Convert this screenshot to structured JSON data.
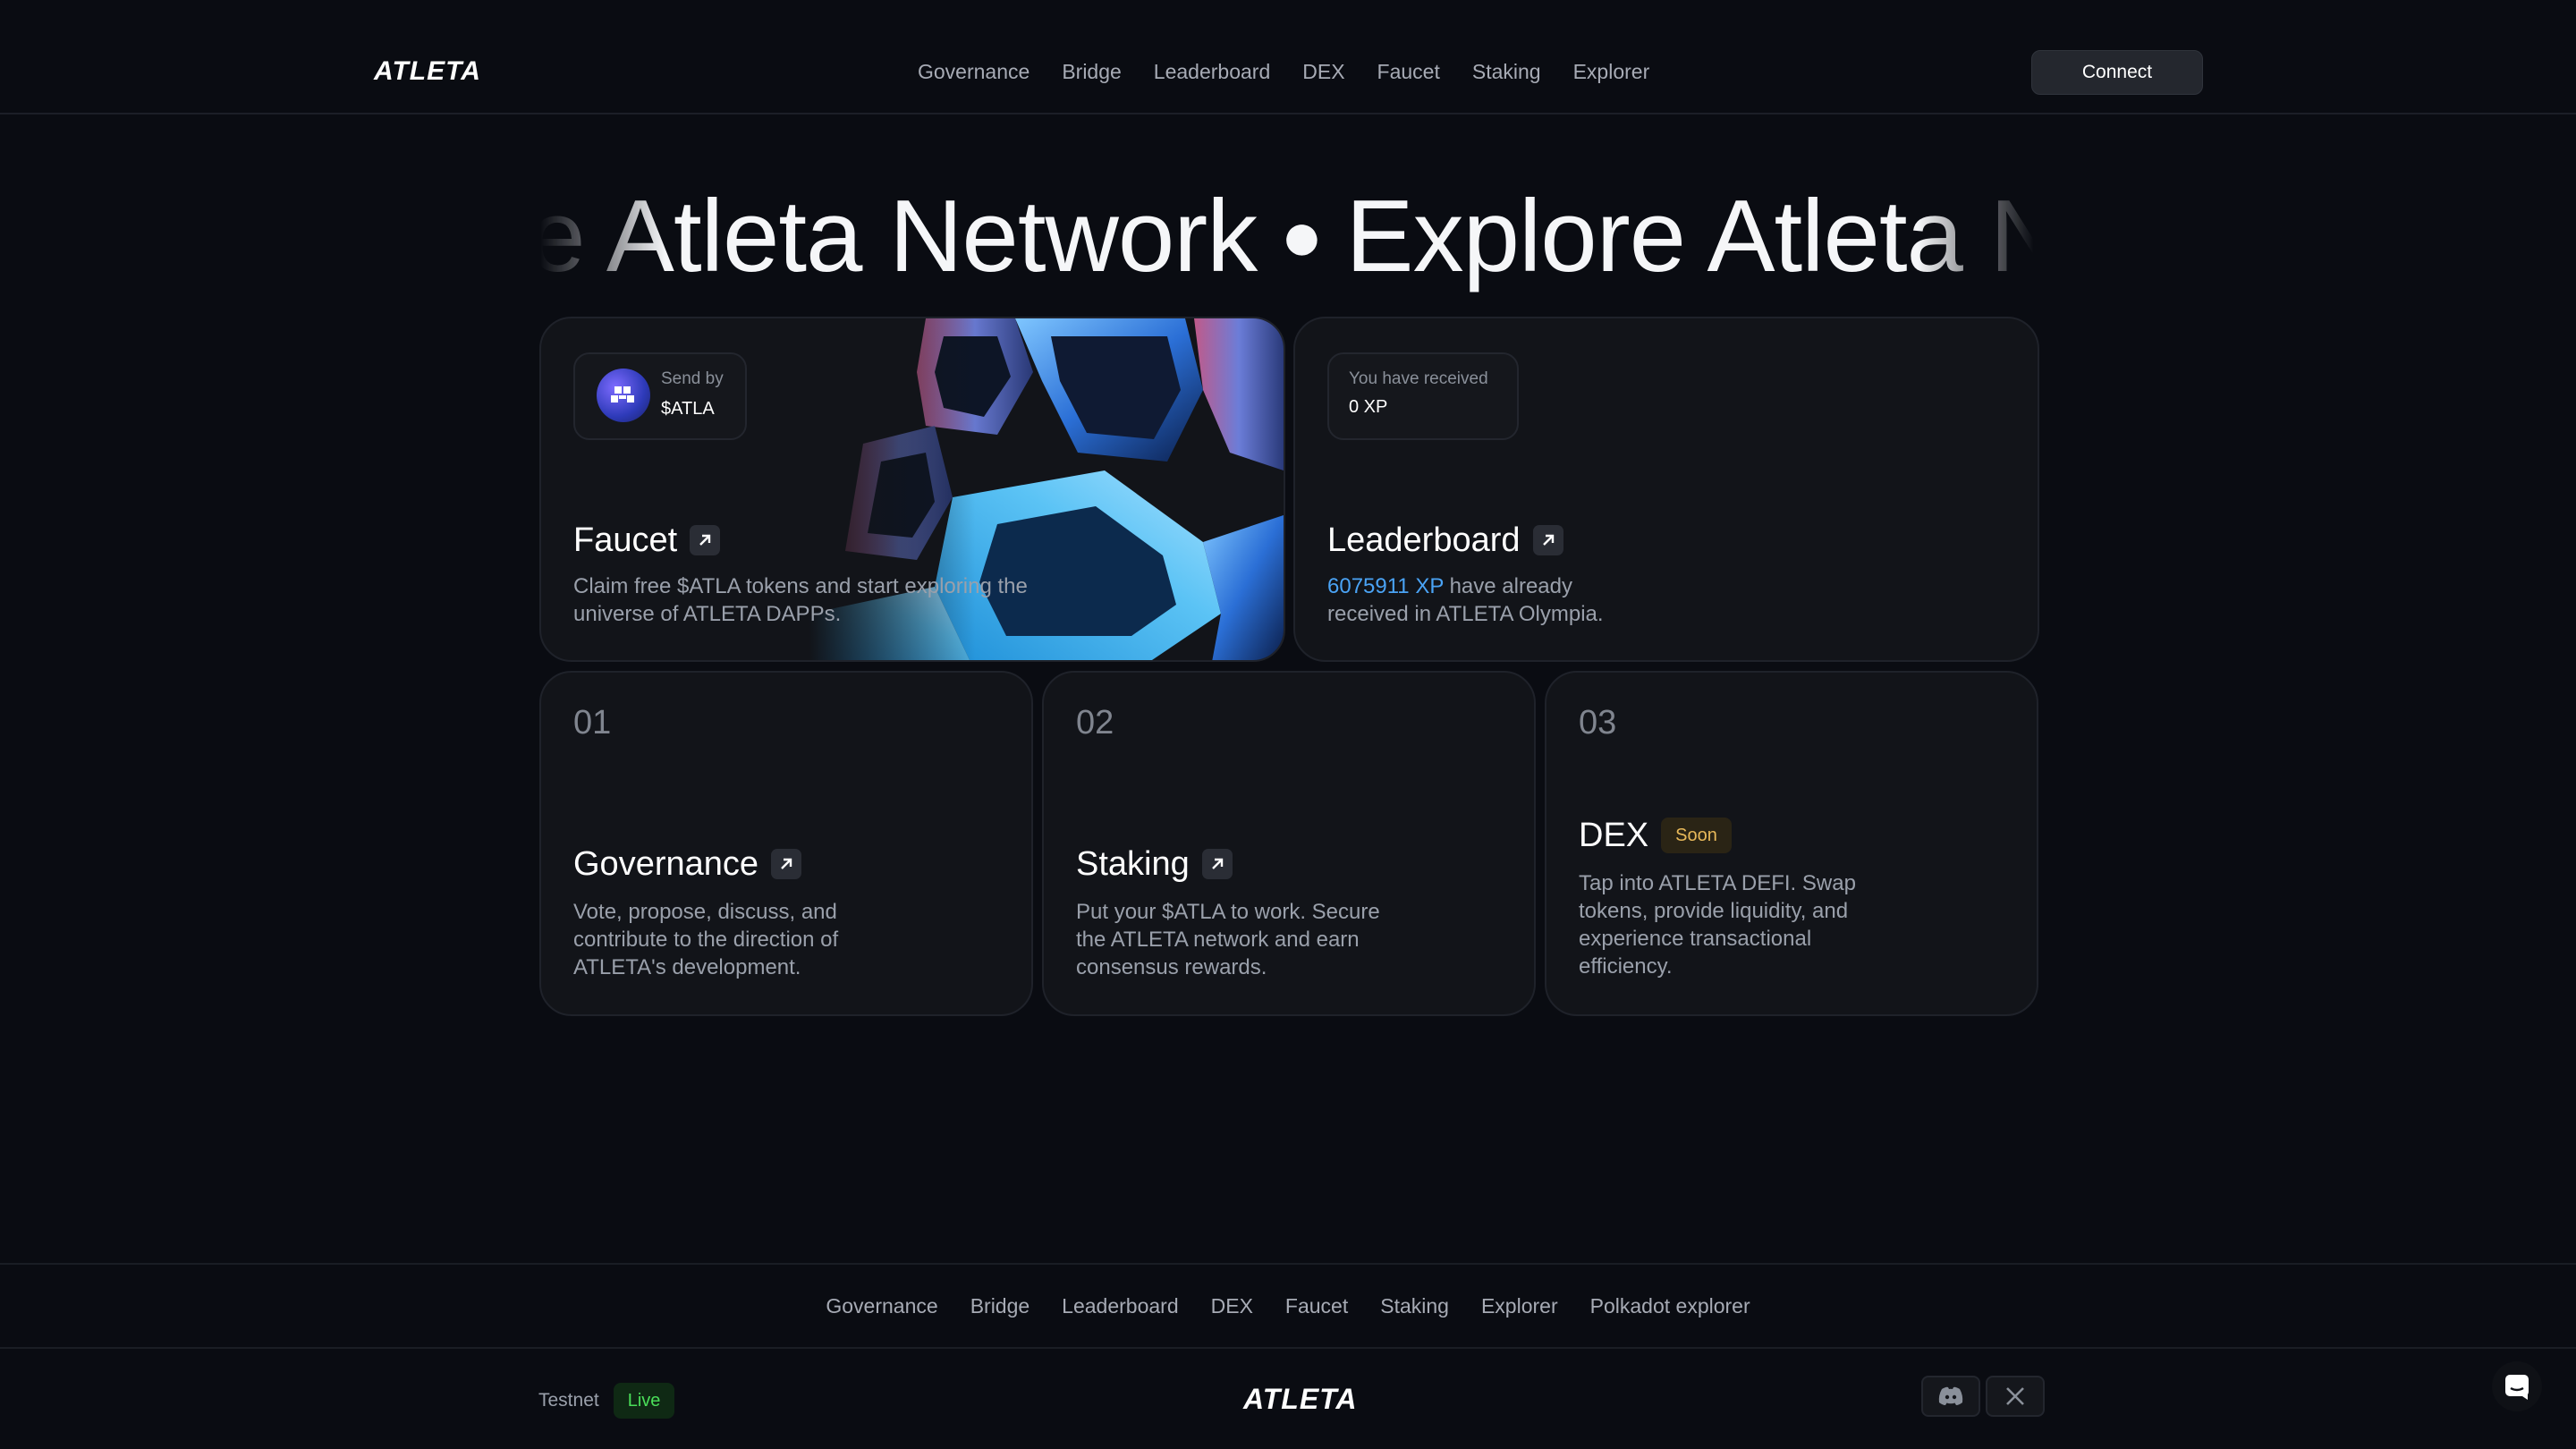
{
  "header": {
    "logo": "ATLETA",
    "nav": [
      "Governance",
      "Bridge",
      "Leaderboard",
      "DEX",
      "Faucet",
      "Staking",
      "Explorer"
    ],
    "connect_label": "Connect"
  },
  "hero": {
    "marquee_text": "Explore Atleta Network"
  },
  "faucet": {
    "pill_label": "Send by",
    "pill_value": "$ATLA",
    "title": "Faucet",
    "description_line1": "Claim free $ATLA tokens and start exploring the",
    "description_line2": "universe of ATLETA DAPPs."
  },
  "leaderboard": {
    "pill_label": "You have received",
    "pill_value": "0 XP",
    "title": "Leaderboard",
    "xp_value": "6075911 XP",
    "description_rest1": " have already",
    "description_line2": "received in ATLETA Olympia."
  },
  "features": [
    {
      "number": "01",
      "title": "Governance",
      "line1": "Vote, propose, discuss, and",
      "line2": "contribute to the direction of",
      "line3": "ATLETA's development."
    },
    {
      "number": "02",
      "title": "Staking",
      "line1": "Put your $ATLA to work. Secure",
      "line2": "the ATLETA network and earn",
      "line3": "consensus rewards."
    },
    {
      "number": "03",
      "title": "DEX",
      "badge": "Soon",
      "line1": "Tap into ATLETA DEFI. Swap",
      "line2": "tokens, provide liquidity, and",
      "line3": "experience transactional",
      "line4": "efficiency."
    }
  ],
  "footer": {
    "links": [
      "Governance",
      "Bridge",
      "Leaderboard",
      "DEX",
      "Faucet",
      "Staking",
      "Explorer",
      "Polkadot explorer"
    ],
    "testnet_label": "Testnet",
    "live_label": "Live",
    "logo": "ATLETA"
  },
  "colors": {
    "background": "#0a0c12",
    "card": "#121419",
    "accent_blue": "#4aa3f5",
    "live_green": "#4ade59",
    "soon_gold": "#e8b95a"
  },
  "icons": [
    "arrow-up-right-icon",
    "discord-icon",
    "x-icon",
    "chat-icon",
    "atla-token-icon"
  ]
}
